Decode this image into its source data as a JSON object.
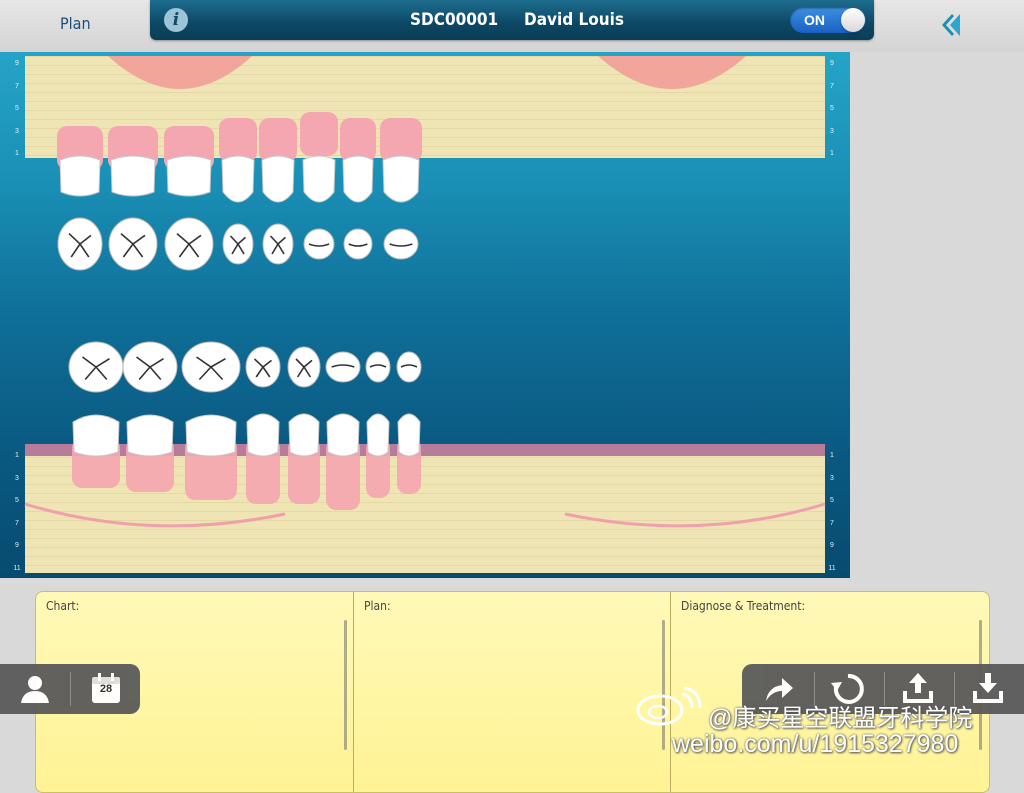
{
  "header": {
    "plan_tab": "Plan",
    "info_icon": "i",
    "patient_id": "SDC00001",
    "patient_name": "David Louis",
    "toggle_label": "ON",
    "toggle_state": "on",
    "collapse_icon": "double-chevron-left-icon"
  },
  "chart": {
    "scale_upper": [
      "9",
      "7",
      "5",
      "3",
      "1"
    ],
    "scale_lower": [
      "1",
      "3",
      "5",
      "7",
      "9",
      "11"
    ],
    "colors": {
      "gum": "#f4a7b0",
      "bone": "#efe4b4",
      "tooth": "#ffffff",
      "gum_line": "#b77c9b",
      "background": "#1a8fb5"
    }
  },
  "notes": {
    "chart_label": "Chart:",
    "plan_label": "Plan:",
    "diagnose_label": "Diagnose & Treatment:"
  },
  "toolbar_left": {
    "items": [
      "person-icon",
      "calendar-icon"
    ],
    "calendar_day": "28"
  },
  "toolbar_right": {
    "items": [
      "share-icon",
      "refresh-icon",
      "upload-icon",
      "download-icon"
    ]
  },
  "watermark": {
    "line1": "@康买星空联盟牙科学院",
    "line2": "weibo.com/u/1915327980"
  }
}
